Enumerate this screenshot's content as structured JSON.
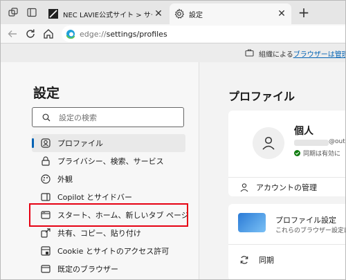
{
  "browser": {
    "tabs": [
      {
        "title": "NEC LAVIE公式サイト > サービス&サ",
        "active": false
      },
      {
        "title": "設定",
        "active": true
      }
    ],
    "address": {
      "scheme": "edge://",
      "path": "settings/profiles"
    },
    "banner": {
      "prefix": "組織による",
      "link": "ブラウザーは管理されて"
    }
  },
  "settings": {
    "title": "設定",
    "search_placeholder": "設定の検索",
    "nav": [
      {
        "label": "プロファイル",
        "icon": "profile-icon",
        "selected": true
      },
      {
        "label": "プライバシー、検索、サービス",
        "icon": "lock-icon"
      },
      {
        "label": "外観",
        "icon": "appearance-icon"
      },
      {
        "label": "Copilot とサイドバー",
        "icon": "copilot-icon"
      },
      {
        "label": "スタート、ホーム、新しいタブ ページ",
        "icon": "start-page-icon",
        "highlighted": true
      },
      {
        "label": "共有、コピー、貼り付け",
        "icon": "share-icon"
      },
      {
        "label": "Cookie とサイトのアクセス許可",
        "icon": "cookie-icon"
      },
      {
        "label": "既定のブラウザー",
        "icon": "browser-icon"
      }
    ]
  },
  "profile": {
    "heading": "プロファイル",
    "user_name": "個人",
    "email_domain": "@out",
    "sync_status": "同期は有効に",
    "account_manage": "アカウントの管理",
    "profile_settings_title": "プロファイル設定",
    "profile_settings_desc": "これらのブラウザー設定は、",
    "sync_label": "同期"
  },
  "colors": {
    "highlight": "#e60012",
    "accent": "#0062b4"
  }
}
